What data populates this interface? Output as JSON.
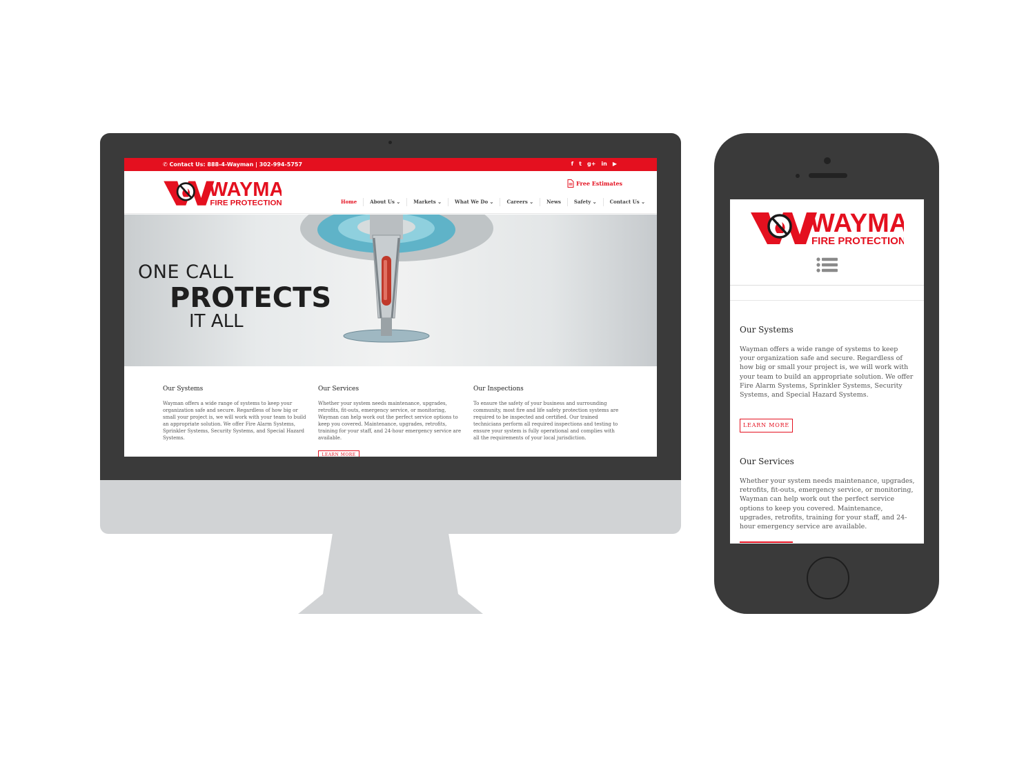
{
  "brand": {
    "name": "WAYMAN",
    "tagline": "FIRE PROTECTION",
    "accent_color": "#e4101f"
  },
  "topbar": {
    "contact": "Contact Us: 888-4-Wayman | 302-994-5757",
    "phone_icon": "phone-icon",
    "social_icons": [
      "facebook-icon",
      "twitter-icon",
      "google-plus-icon",
      "linkedin-icon",
      "youtube-icon"
    ],
    "social_glyphs": [
      "f",
      "t",
      "g+",
      "in",
      "▶"
    ]
  },
  "header": {
    "free_estimates": "Free Estimates",
    "free_estimates_icon": "document-icon"
  },
  "nav": {
    "items": [
      {
        "label": "Home",
        "active": true,
        "dropdown": false
      },
      {
        "label": "About Us",
        "active": false,
        "dropdown": true
      },
      {
        "label": "Markets",
        "active": false,
        "dropdown": true
      },
      {
        "label": "What We Do",
        "active": false,
        "dropdown": true
      },
      {
        "label": "Careers",
        "active": false,
        "dropdown": true
      },
      {
        "label": "News",
        "active": false,
        "dropdown": false
      },
      {
        "label": "Safety",
        "active": false,
        "dropdown": true
      },
      {
        "label": "Contact Us",
        "active": false,
        "dropdown": true
      }
    ]
  },
  "hero": {
    "line1": "ONE CALL",
    "line2": "PROTECTS",
    "line3": "IT ALL"
  },
  "sections": [
    {
      "title": "Our Systems",
      "body": "Wayman offers a wide range of systems to keep your organization safe and secure. Regardless of how big or small your project is, we will work with your team to build an appropriate solution. We offer Fire Alarm Systems, Sprinkler Systems, Security Systems, and Special Hazard Systems."
    },
    {
      "title": "Our Services",
      "body": "Whether your system needs maintenance, upgrades, retrofits, fit-outs, emergency service, or monitoring, Wayman can help work out the perfect service options to keep you covered. Maintenance, upgrades, retrofits, training for your staff, and 24-hour emergency service are available."
    },
    {
      "title": "Our Inspections",
      "body": "To ensure the safety of your business and surrounding community, most fire and life safety protection systems are required to be inspected and certified. Our trained technicians perform all required inspections and testing to ensure your system is fully operational and complies with all the requirements of your local jurisdiction."
    }
  ],
  "buttons": {
    "learn_more": "LEARN MORE"
  },
  "mobile": {
    "menu_icon": "list-menu-icon"
  }
}
